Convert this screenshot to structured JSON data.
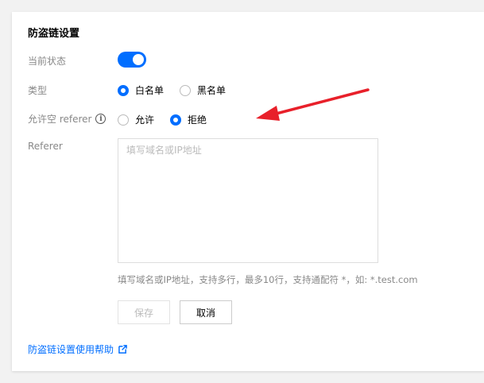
{
  "panel": {
    "title": "防盗链设置"
  },
  "status": {
    "label": "当前状态",
    "enabled": true
  },
  "type": {
    "label": "类型",
    "options": [
      "白名单",
      "黑名单"
    ],
    "selected": "白名单"
  },
  "empty_referer": {
    "label": "允许空 referer",
    "info_icon": "i",
    "options": [
      "允许",
      "拒绝"
    ],
    "selected": "拒绝"
  },
  "referer": {
    "label": "Referer",
    "placeholder": "填写域名或IP地址",
    "value": "",
    "hint": "填写域名或IP地址，支持多行，最多10行，支持通配符 *，如: *.test.com"
  },
  "buttons": {
    "save": "保存",
    "cancel": "取消"
  },
  "help": {
    "link_text": "防盗链设置使用帮助"
  },
  "colors": {
    "accent": "#006eff",
    "annotation_arrow": "#e8202a"
  }
}
